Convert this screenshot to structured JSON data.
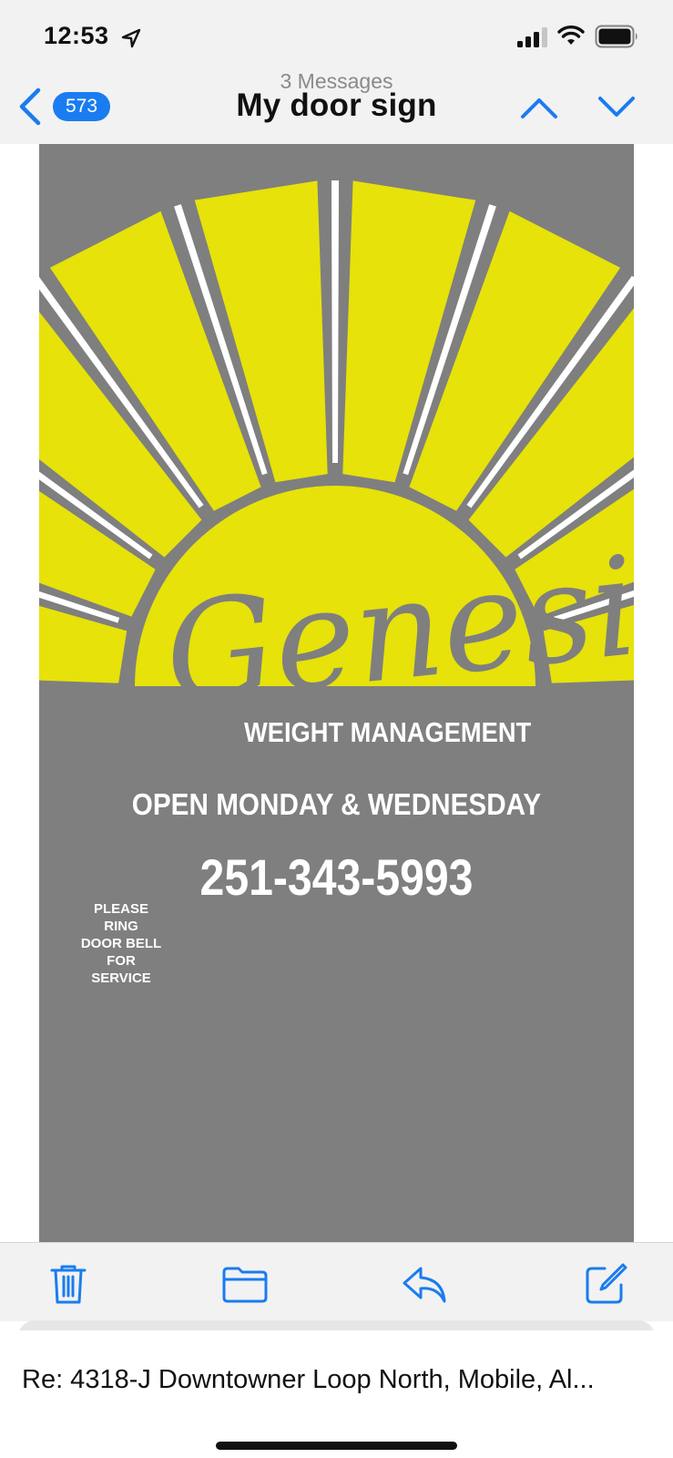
{
  "status_bar": {
    "time": "12:53",
    "icons": [
      "location-arrow-icon",
      "cellular-signal-icon",
      "wifi-icon",
      "battery-icon"
    ]
  },
  "nav_bar": {
    "unread_count": "573",
    "message_count": "3 Messages",
    "title": "My door sign",
    "icons": [
      "chevron-left-icon",
      "chevron-up-icon",
      "chevron-down-icon"
    ]
  },
  "sign": {
    "brand": "Genesis",
    "subtitle": "WEIGHT MANAGEMENT",
    "hours": "OPEN MONDAY & WEDNESDAY",
    "phone": "251-343-5993",
    "note_lines": [
      "PLEASE RING",
      "DOOR BELL",
      "FOR SERVICE"
    ],
    "colors": {
      "background": "#7f7f7f",
      "sun": "#e6e20a",
      "rays_white": "#ffffff"
    }
  },
  "toolbar": {
    "icons": [
      "trash-icon",
      "folder-icon",
      "reply-icon",
      "compose-icon"
    ]
  },
  "bottom_sheet": {
    "subject": "Re: 4318-J Downtowner Loop North, Mobile, Al..."
  },
  "colors": {
    "accent": "#1a7cf0",
    "chrome_bg": "#f2f2f2"
  }
}
